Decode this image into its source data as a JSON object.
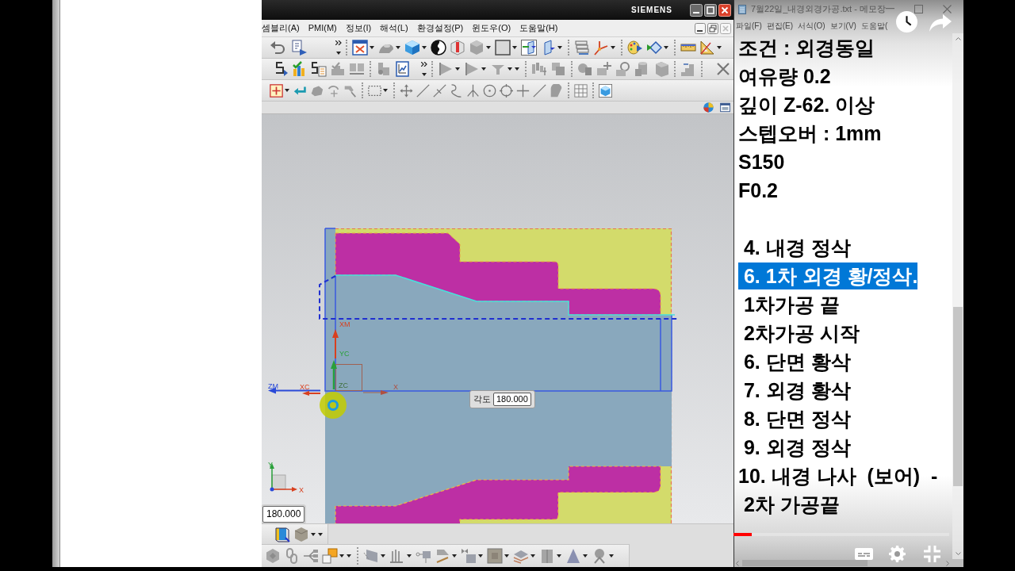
{
  "nx_window": {
    "brand": "SIEMENS",
    "menu": [
      "셈블리(A)",
      "PMI(M)",
      "정보(I)",
      "해석(L)",
      "환경설정(P)",
      "윈도우(O)",
      "도움말(H)"
    ],
    "viewport": {
      "axis_labels": [
        "XM",
        "YC",
        "ZM",
        "XC",
        "ZC",
        "X"
      ],
      "triad_labels": [
        "Y",
        "X"
      ],
      "angle_field": {
        "label": "각도",
        "value": "180.000"
      },
      "value_field": {
        "value": "180.000"
      }
    }
  },
  "notepad": {
    "title": "7월22일_내경외경가공.txt - 메모장",
    "menu": [
      "파일(F)",
      "편집(E)",
      "서식(O)",
      "보기(V)",
      "도움말("
    ],
    "lines_top": [
      {
        "text": "조건 : 외경동일",
        "selected": false
      },
      {
        "text": "여유량 0.2",
        "selected": false
      },
      {
        "text": "깊이 Z-62. 이상",
        "selected": false
      },
      {
        "text": "스텝오버 : 1mm",
        "selected": false
      },
      {
        "text": "S150",
        "selected": false
      },
      {
        "text": "F0.2",
        "selected": false
      }
    ],
    "lines_bottom": [
      {
        "text": " 4. 내경 정삭",
        "selected": false
      },
      {
        "text": " 6. 1차 외경 황/정삭.",
        "selected": true
      },
      {
        "text": " 1차가공 끝",
        "selected": false
      },
      {
        "text": " 2차가공 시작",
        "selected": false
      },
      {
        "text": " 6. 단면 황삭",
        "selected": false
      },
      {
        "text": " 7. 외경 황삭",
        "selected": false
      },
      {
        "text": " 8. 단면 정삭",
        "selected": false
      },
      {
        "text": " 9. 외경 정삭",
        "selected": false
      },
      {
        "text": "10. 내경 나사  (보어)  -",
        "selected": false
      },
      {
        "text": " 2차 가공끝",
        "selected": false
      }
    ]
  },
  "player": {
    "progress": {
      "level": 0.085
    }
  }
}
